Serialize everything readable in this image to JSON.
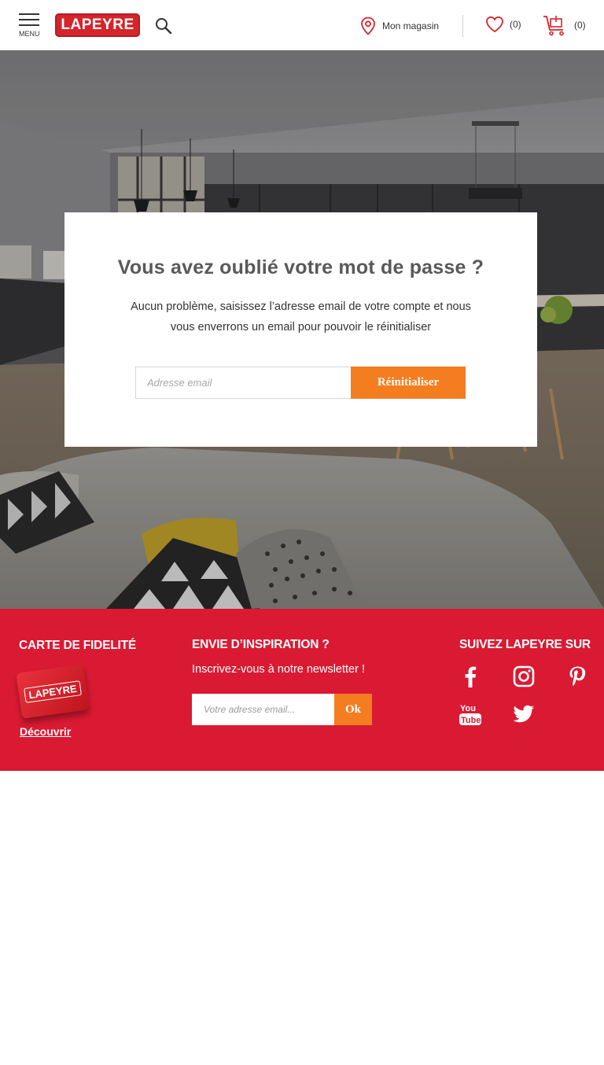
{
  "header": {
    "menu_label": "MENU",
    "logo_text": "LAPEYRE",
    "store_label": "Mon magasin",
    "favorites_count": "(0)",
    "cart_count": "(0)"
  },
  "reset": {
    "title": "Vous avez oublié votre mot de passe ?",
    "description": "Aucun problème, saisissez l’adresse email de votre compte et nous vous enverrons un email pour pouvoir le réinitialiser",
    "email_placeholder": "Adresse email",
    "submit_label": "Réinitialiser"
  },
  "footer": {
    "loyalty": {
      "title": "CARTE DE FIDELITÉ",
      "card_text": "LAPEYRE",
      "link_label": "Découvrir"
    },
    "newsletter": {
      "title": "ENVIE D’INSPIRATION ?",
      "subtitle": "Inscrivez-vous à notre newsletter !",
      "email_placeholder": "Votre adresse email...",
      "submit_label": "Ok"
    },
    "social": {
      "title": "SUIVEZ LAPEYRE SUR",
      "networks": [
        "facebook-icon",
        "instagram-icon",
        "pinterest-icon",
        "youtube-icon",
        "twitter-icon"
      ]
    }
  },
  "colors": {
    "brand_red": "#da1a32",
    "accent_orange": "#f47d20",
    "title_gray": "#595959"
  }
}
